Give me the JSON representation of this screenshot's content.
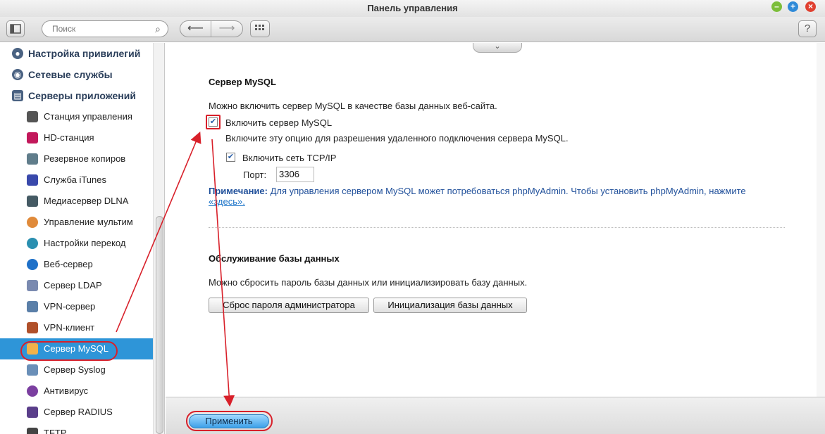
{
  "window": {
    "title": "Панель управления"
  },
  "toolbar": {
    "search_placeholder": "Поиск",
    "back_glyph": "⟵",
    "forward_glyph": "⟶",
    "apps_glyph": "⋮⋮⋮",
    "help_label": "?"
  },
  "sidebar": {
    "sections": [
      {
        "label": "Настройка привилегий",
        "icon": "user-icon"
      },
      {
        "label": "Сетевые службы",
        "icon": "network-icon"
      },
      {
        "label": "Серверы приложений",
        "icon": "server-icon"
      }
    ],
    "items": [
      {
        "label": "Станция управления",
        "icon": "station-icon"
      },
      {
        "label": "HD-станция",
        "icon": "hd-icon"
      },
      {
        "label": "Резервное копиров",
        "icon": "backup-icon"
      },
      {
        "label": "Служба iTunes",
        "icon": "itunes-icon"
      },
      {
        "label": "Медиасервер DLNA",
        "icon": "dlna-icon"
      },
      {
        "label": "Управление мультим",
        "icon": "multimedia-icon"
      },
      {
        "label": "Настройки перекод",
        "icon": "transcode-icon"
      },
      {
        "label": "Веб-сервер",
        "icon": "globe-icon"
      },
      {
        "label": "Сервер LDAP",
        "icon": "ldap-icon"
      },
      {
        "label": "VPN-сервер",
        "icon": "vpn-server-icon"
      },
      {
        "label": "VPN-клиент",
        "icon": "vpn-client-icon"
      },
      {
        "label": "Сервер MySQL",
        "icon": "mysql-icon"
      },
      {
        "label": "Сервер Syslog",
        "icon": "syslog-icon"
      },
      {
        "label": "Антивирус",
        "icon": "antivirus-icon"
      },
      {
        "label": "Сервер RADIUS",
        "icon": "radius-icon"
      },
      {
        "label": "TFTP",
        "icon": "tftp-icon"
      }
    ],
    "active_item": "Сервер MySQL"
  },
  "mysql": {
    "title": "Сервер MySQL",
    "description": "Можно включить сервер MySQL в качестве базы данных веб-сайта.",
    "enable_label": "Включить сервер MySQL",
    "enable_checked": true,
    "enable_hint": "Включите эту опцию для разрешения удаленного подключения сервера MySQL.",
    "tcp_label": "Включить сеть TCP/IP",
    "tcp_checked": true,
    "port_label": "Порт:",
    "port_value": "3306",
    "note_label": "Примечание:",
    "note_text": " Для управления сервером MySQL может потребоваться phpMyAdmin. Чтобы установить phpMyAdmin, нажмите",
    "note_link": "«здесь»."
  },
  "maintenance": {
    "title": "Обслуживание базы данных",
    "description": "Можно сбросить пароль базы данных или инициализировать базу данных.",
    "reset_button": "Сброс пароля администратора",
    "init_button": "Инициализация базы данных"
  },
  "footer": {
    "apply_button": "Применить"
  },
  "colors": {
    "accent": "#2e95d8",
    "annotation_red": "#d8202a",
    "note_blue": "#1f4f9a"
  }
}
